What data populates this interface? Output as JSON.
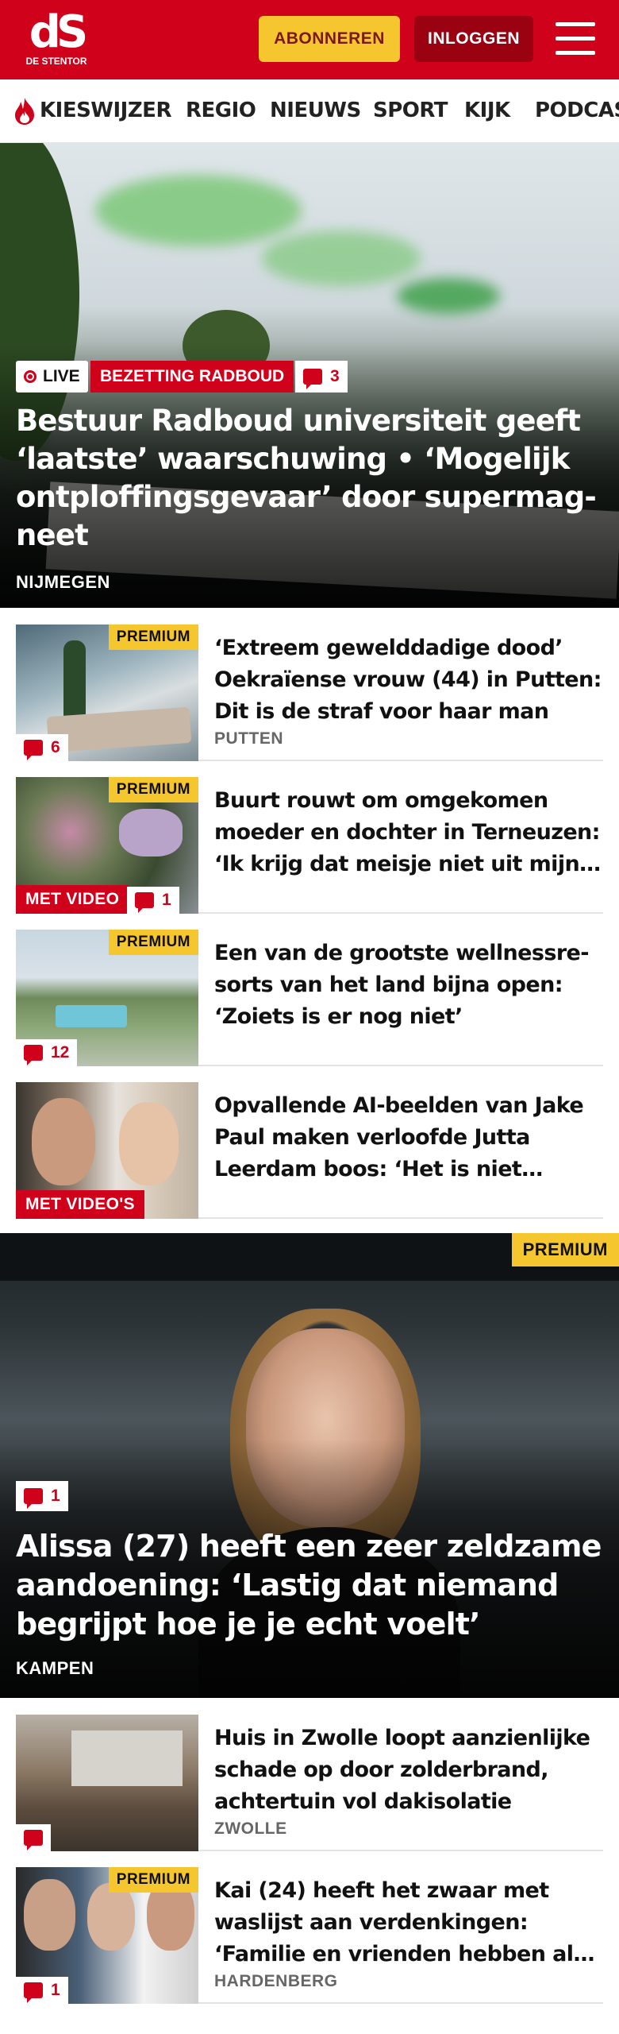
{
  "brand": {
    "logo_text": "dS",
    "logo_sub": "DE STENTOR",
    "color": "#d0021b"
  },
  "header": {
    "subscribe_label": "ABONNEREN",
    "login_label": "INLOGGEN"
  },
  "nav": {
    "items": [
      "KIESWIJZER",
      "REGIO",
      "NIEUWS",
      "SPORT",
      "KIJK",
      "PODCASTS"
    ]
  },
  "hero": {
    "live_label": "LIVE",
    "topic": "BEZETTING RADBOUD",
    "comments": "3",
    "title": "Bestuur Radboud universiteit geeft ‘laatste’ waarschuwing • ‘Mogelijk ontploffingsgevaar’ door supermag-neet",
    "location": "NIJMEGEN"
  },
  "articles": [
    {
      "title": "‘Extreem gewelddadige dood’ Oekraïense vrouw (44) in Putten: Dit is de straf voor haar man",
      "location": "PUTTEN",
      "premium": "PREMIUM",
      "comments": "6",
      "video": ""
    },
    {
      "title": "Buurt rouwt om omgekomen moeder en dochter in Terneuzen: ‘Ik krijg dat meisje niet uit mijn…",
      "location": "",
      "premium": "PREMIUM",
      "comments": "1",
      "video": "MET VIDEO"
    },
    {
      "title": "Een van de grootste wellnessre-sorts van het land bijna open: ‘Zoiets is er nog niet’",
      "location": "",
      "premium": "PREMIUM",
      "comments": "12",
      "video": ""
    },
    {
      "title": "Opvallende AI-beelden van Jake Paul maken verloofde Jutta Leerdam boos: ‘Het is niet…",
      "location": "",
      "premium": "",
      "comments": "",
      "video": "MET VIDEO'S"
    }
  ],
  "feature": {
    "premium": "PREMIUM",
    "comments": "1",
    "title": "Alissa (27) heeft een zeer zeldzame aandoening: ‘Lastig dat niemand begrijpt hoe je je echt voelt’",
    "location": "KAMPEN"
  },
  "articles2": [
    {
      "title": "Huis in Zwolle loopt aanzienlijke schade op door zolderbrand, achtertuin vol dakisolatie",
      "location": "ZWOLLE",
      "premium": "",
      "comments": ""
    },
    {
      "title": "Kai (24) heeft het zwaar met waslijst aan verdenkingen: ‘Familie en vrienden hebben al…",
      "location": "HARDENBERG",
      "premium": "PREMIUM",
      "comments": "1"
    }
  ]
}
